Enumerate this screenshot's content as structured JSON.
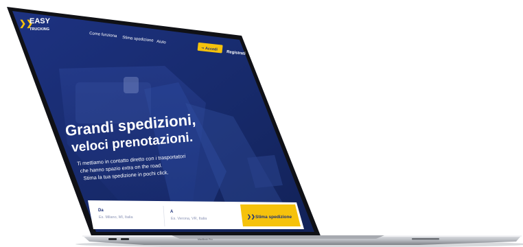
{
  "brand": {
    "logo_line1": "EASY",
    "logo_line2": "TRUCKING"
  },
  "nav": {
    "items": [
      "Come funziona",
      "Stima spedizione",
      "Aiuto"
    ],
    "login_label": "Accedi",
    "register_label": "Registrati"
  },
  "hero": {
    "title_line1": "Grandi spedizioni,",
    "title_line2": "veloci prenotazioni.",
    "subtitle_line1": "Ti mettiamo in contatto diretto con i trasportatori",
    "subtitle_line2": "che hanno spazio extra on the road.",
    "subtitle_line3": "Stima la tua spedizione in pochi click."
  },
  "search": {
    "from_label": "Da",
    "from_placeholder": "Es. Milano, MI, Italia",
    "to_label": "A",
    "to_placeholder": "Es. Verona, VR, Italia",
    "submit_label": "Stima spedizione"
  },
  "device": {
    "model_label": "MacBook Pro"
  },
  "colors": {
    "screen_blue": "#1b2f78",
    "accent_yellow": "#f5c20c",
    "aluminium": "#c9ccd1"
  }
}
